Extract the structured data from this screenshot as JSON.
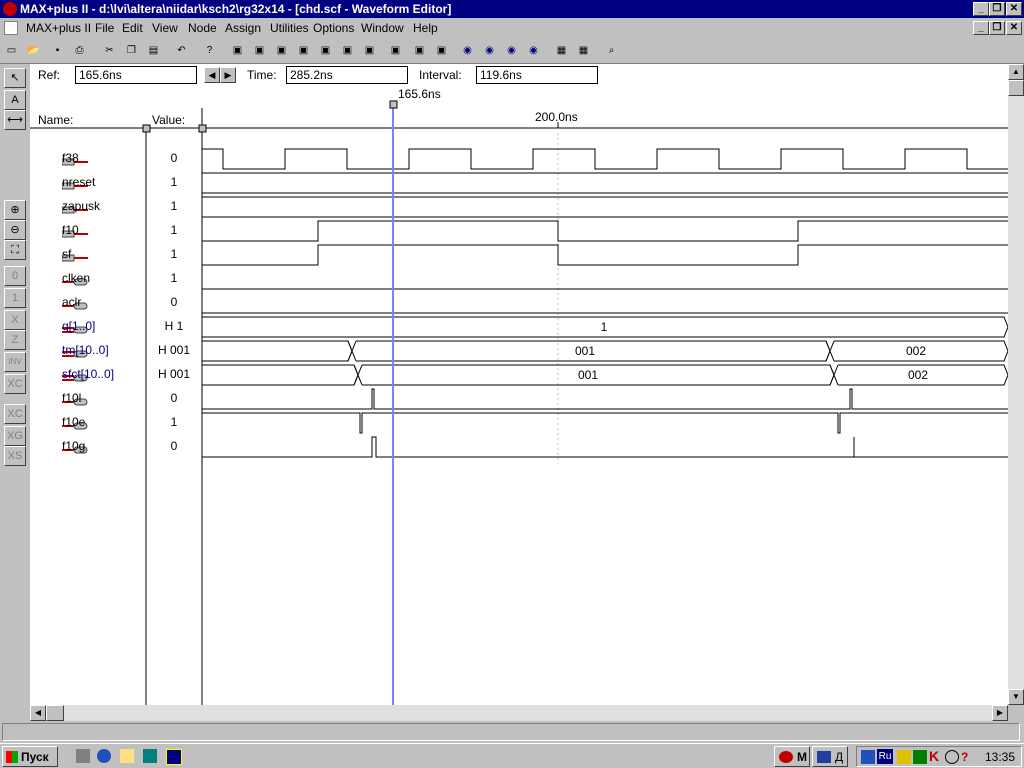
{
  "window": {
    "title": "MAX+plus II - d:\\lvi\\altera\\niidar\\ksch2\\rg32x14 - [chd.scf - Waveform Editor]"
  },
  "menu": [
    "MAX+plus II",
    "File",
    "Edit",
    "View",
    "Node",
    "Assign",
    "Utilities",
    "Options",
    "Window",
    "Help"
  ],
  "toolbar_icons": [
    "new-file-icon",
    "open-icon",
    "save-icon",
    "print-icon",
    "cut-icon",
    "copy-icon",
    "paste-icon",
    "undo-icon",
    "help-cursor-icon",
    "hierarchy-up-icon",
    "compile-icon",
    "simulate-icon",
    "timing-icon",
    "programmer-icon",
    "floorplan-icon",
    "project-hierarchy-icon",
    "save-check-icon",
    "save-compile-icon",
    "save-simulate-icon",
    "eye-icon",
    "eye-a-icon",
    "eye-b-icon",
    "eye-c-icon",
    "grid-icon",
    "grid-snap-icon",
    "zoom-find-icon"
  ],
  "palette_icons": [
    "pointer-tool-icon",
    "text-tool-icon",
    "node-tool-icon",
    "zoom-in-icon",
    "zoom-out-icon",
    "fit-in-window-icon",
    "set-0-icon",
    "set-1-icon",
    "set-x-icon",
    "set-z-icon",
    "invert-icon",
    "overwrite-count-icon",
    "overwrite-clock-icon",
    "overwrite-group-icon",
    "overwrite-state-icon"
  ],
  "timebar": {
    "ref_label": "Ref:",
    "ref_value": "165.6ns",
    "time_label": "Time:",
    "time_value": "285.2ns",
    "interval_label": "Interval:",
    "interval_value": "119.6ns",
    "cursor_label": "165.6ns",
    "tick_label": "200.0ns"
  },
  "columns": {
    "name": "Name:",
    "value": "Value:"
  },
  "signals": [
    {
      "name": "f38",
      "value": "0",
      "type": "input"
    },
    {
      "name": "nreset",
      "value": "1",
      "type": "input"
    },
    {
      "name": "zapusk",
      "value": "1",
      "type": "input"
    },
    {
      "name": "f10",
      "value": "1",
      "type": "input"
    },
    {
      "name": "sf",
      "value": "1",
      "type": "input"
    },
    {
      "name": "clken",
      "value": "1",
      "type": "output"
    },
    {
      "name": "aclr",
      "value": "0",
      "type": "output"
    },
    {
      "name": "q[1..0]",
      "value": "H 1",
      "type": "bus"
    },
    {
      "name": "tm[10..0]",
      "value": "H 001",
      "type": "bus"
    },
    {
      "name": "sfct[10..0]",
      "value": "H 001",
      "type": "bus"
    },
    {
      "name": "f10l",
      "value": "0",
      "type": "output"
    },
    {
      "name": "f10e",
      "value": "1",
      "type": "output"
    },
    {
      "name": "f10g",
      "value": "0",
      "type": "output"
    }
  ],
  "bus_values": {
    "q": [
      "1"
    ],
    "tm": [
      "001",
      "002"
    ],
    "sfct": [
      "001",
      "002"
    ]
  },
  "taskbar": {
    "start_label": "Пуск",
    "clock": "13:35",
    "lang": "Ru"
  },
  "colors": {
    "title_bg": "#000080",
    "cursor_line": "#8080ff",
    "bus_name": "#000080"
  }
}
